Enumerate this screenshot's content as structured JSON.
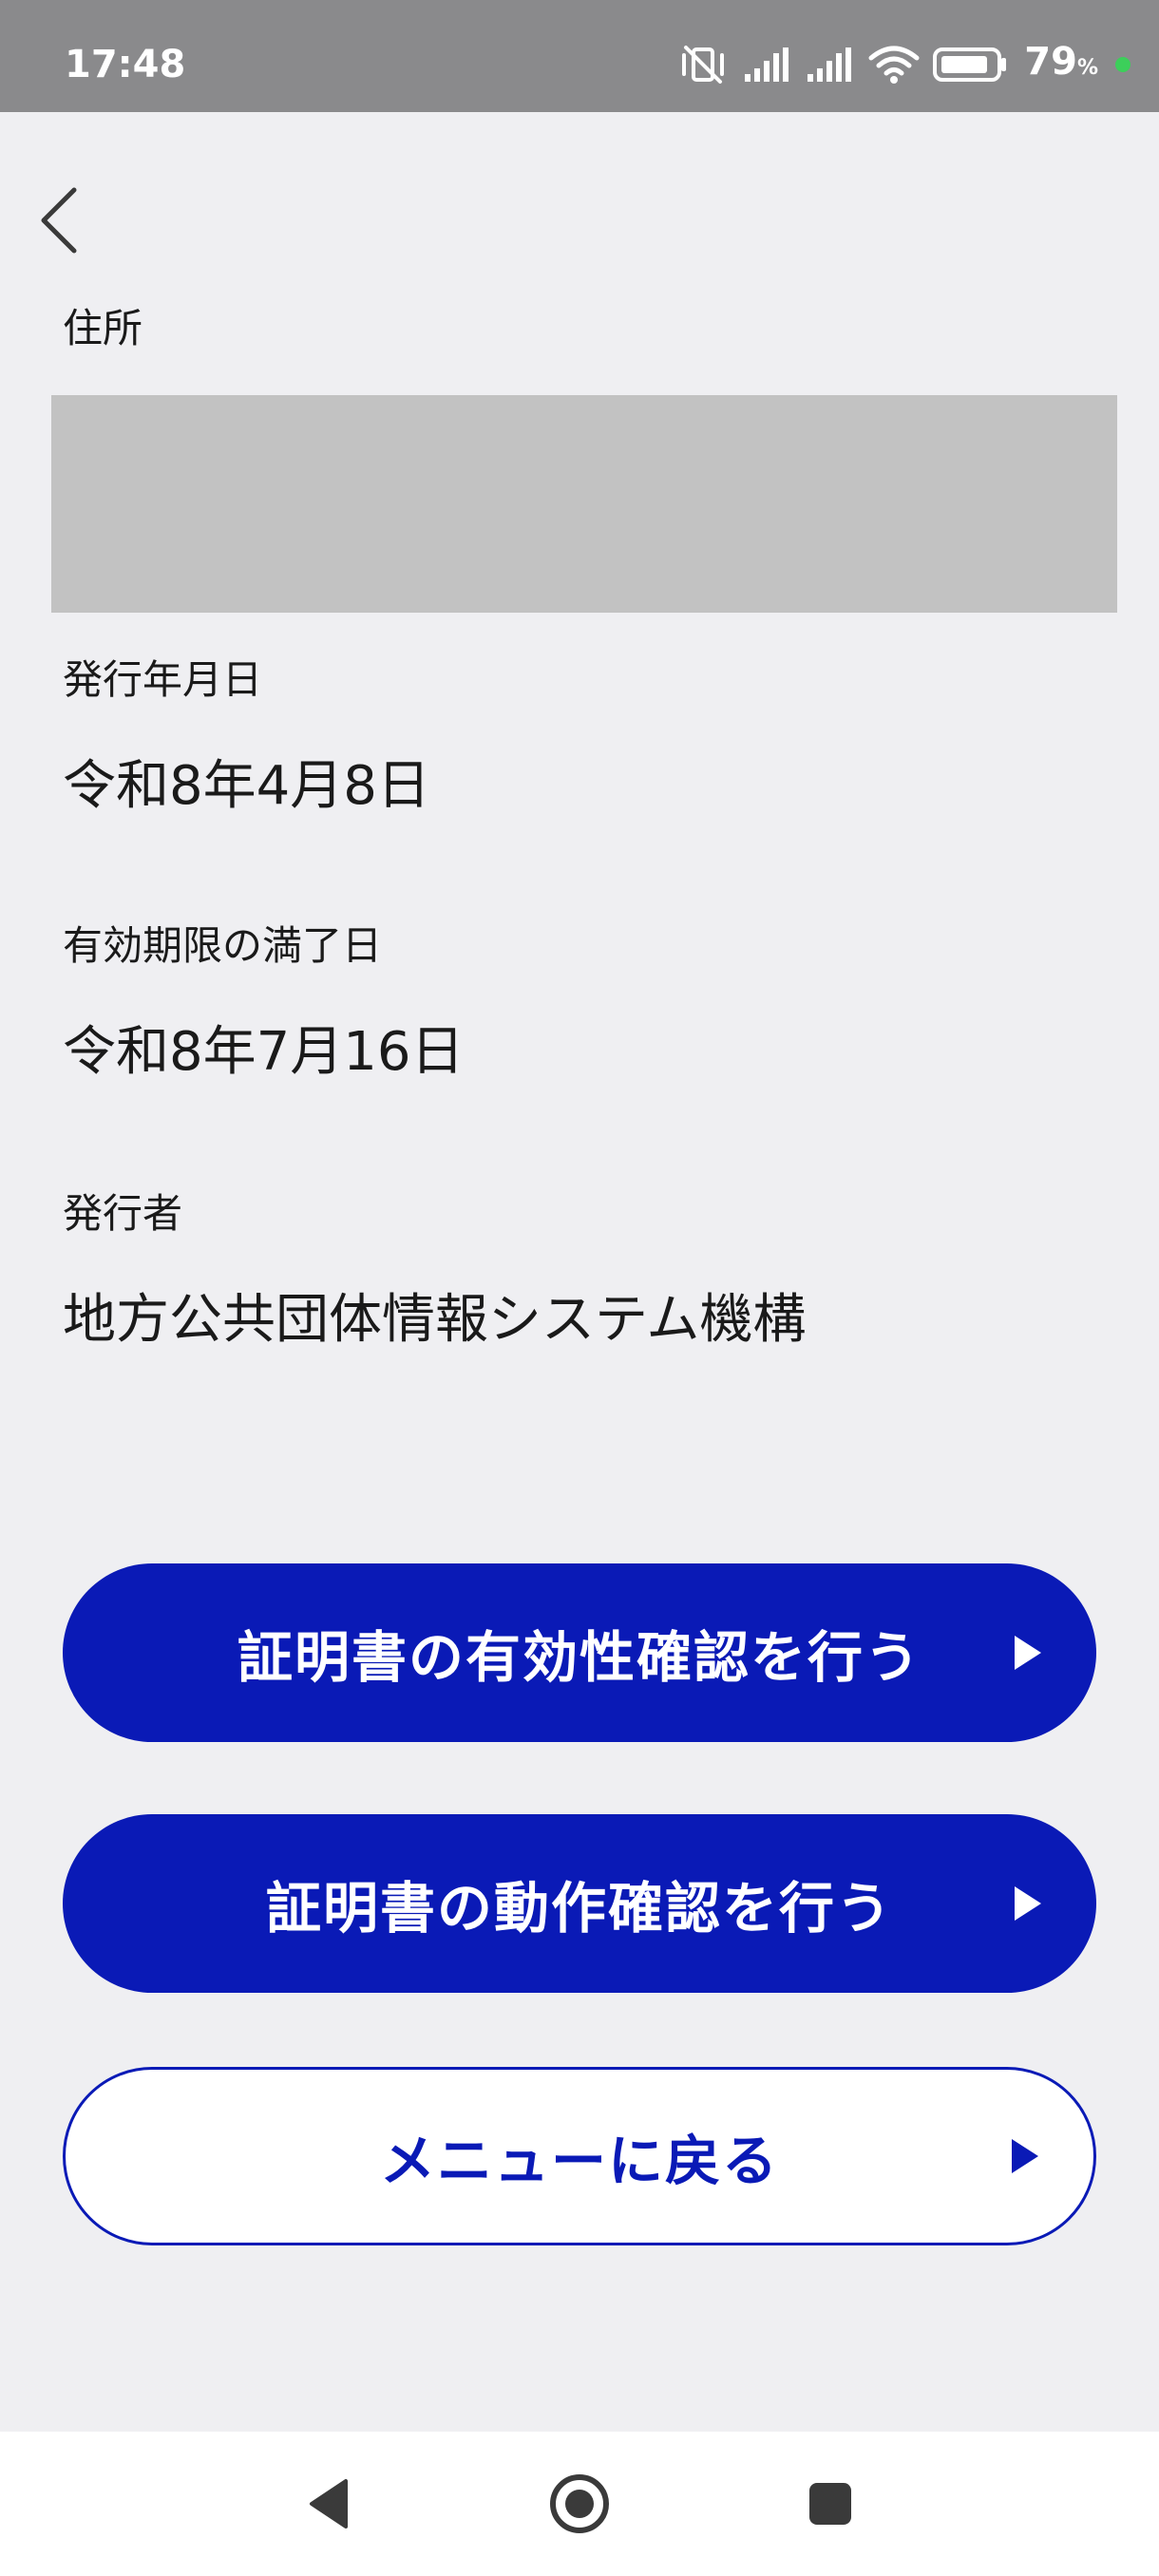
{
  "status_bar": {
    "time": "17:48",
    "battery_percent": "79",
    "battery_percent_sign": "%",
    "icons": [
      "vibrate-off-icon",
      "signal-icon",
      "signal-icon",
      "wifi-icon",
      "battery-icon",
      "charging-dot-icon"
    ],
    "charge_color": "#3ccf5a"
  },
  "header": {
    "back_icon": "chevron-left-icon"
  },
  "fields": {
    "address": {
      "label": "住所"
    },
    "issue_date": {
      "label": "発行年月日",
      "value": "令和8年4月8日"
    },
    "expiry_date": {
      "label": "有効期限の満了日",
      "value": "令和8年7月16日"
    },
    "issuer": {
      "label": "発行者",
      "value": "地方公共団体情報システム機構"
    }
  },
  "buttons": {
    "verify_validity": {
      "label": "証明書の有効性確認を行う",
      "icon": "play-arrow-icon"
    },
    "verify_operation": {
      "label": "証明書の動作確認を行う",
      "icon": "play-arrow-icon"
    },
    "back_to_menu": {
      "label": "メニューに戻る",
      "icon": "play-arrow-icon"
    }
  },
  "nav_bar": {
    "icons": [
      "nav-back-icon",
      "nav-home-icon",
      "nav-recents-icon"
    ]
  },
  "colors": {
    "primary": "#0a1ab6",
    "background": "#efeff2",
    "status_bar": "#8a8a8c",
    "redacted": "#c2c2c2"
  }
}
